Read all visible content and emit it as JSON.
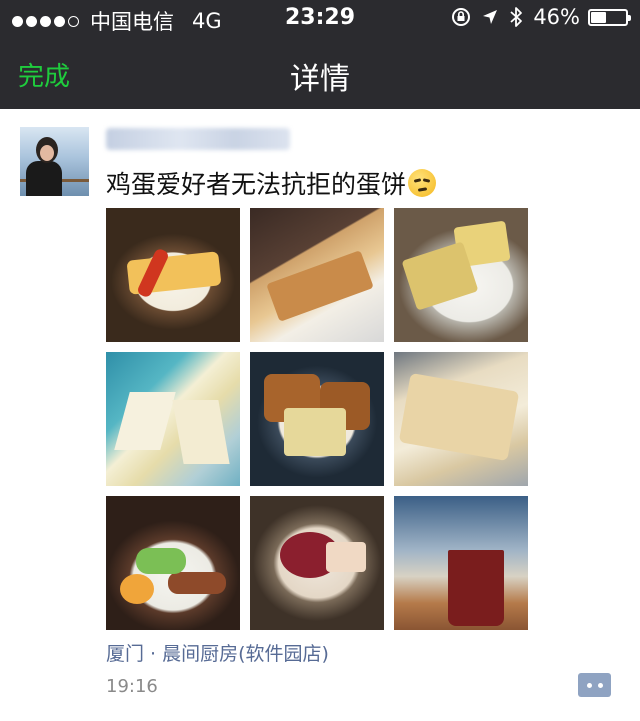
{
  "status_bar": {
    "carrier": "中国电信",
    "network": "4G",
    "time": "23:29",
    "battery_percent": "46%",
    "battery_level": 0.46,
    "signal_bars_filled": 4,
    "signal_bars_total": 5,
    "icons": [
      "orientation-lock-icon",
      "location-arrow-icon",
      "bluetooth-icon",
      "battery-icon"
    ]
  },
  "nav": {
    "done_label": "完成",
    "title": "详情"
  },
  "post": {
    "author_name": "",
    "text": "鸡蛋爱好者无法抗拒的蛋饼",
    "emoji": "smirking-face-emoji",
    "photos": [
      {
        "subject": "egg-crepe-with-ketchup"
      },
      {
        "subject": "toast-with-sauce"
      },
      {
        "subject": "sandwich-with-bacon"
      },
      {
        "subject": "club-sandwich"
      },
      {
        "subject": "waffle-with-cheese"
      },
      {
        "subject": "thick-toast"
      },
      {
        "subject": "breakfast-platter"
      },
      {
        "subject": "red-bean-dessert"
      },
      {
        "subject": "drink-cup"
      }
    ],
    "location": "厦门 · 晨间厨房(软件园店)",
    "time": "19:16",
    "comment_icon": "comment-dots-icon"
  },
  "colors": {
    "bar_background": "#2b2b2f",
    "done_green": "#1fcc3d",
    "link_blue": "#576b95",
    "comment_button": "#8fa3c2"
  }
}
